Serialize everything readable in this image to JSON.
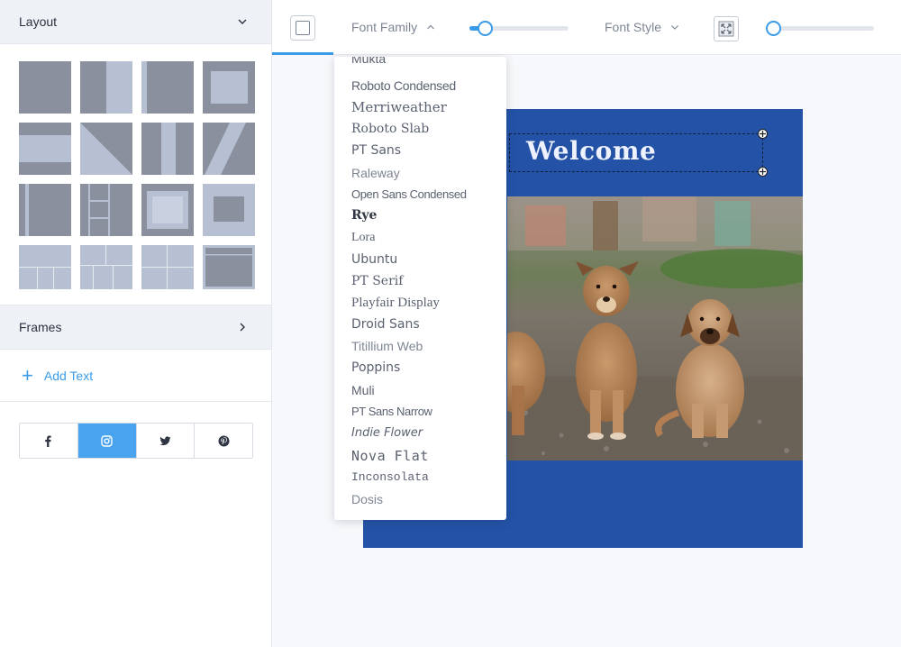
{
  "sidebar": {
    "layout_title": "Layout",
    "frames_title": "Frames",
    "add_text_label": "Add Text",
    "social": [
      {
        "name": "facebook",
        "icon": "facebook-icon",
        "active": false
      },
      {
        "name": "instagram",
        "icon": "instagram-icon",
        "active": true
      },
      {
        "name": "twitter",
        "icon": "twitter-icon",
        "active": false
      },
      {
        "name": "pinterest",
        "icon": "pinterest-icon",
        "active": false
      }
    ]
  },
  "toolbar": {
    "font_family_label": "Font Family",
    "font_style_label": "Font Style",
    "size_slider_value": 0.15,
    "second_slider_value": 0.0
  },
  "font_menu": {
    "items": [
      "Mukta",
      "Roboto Condensed",
      "Merriweather",
      "Roboto Slab",
      "PT Sans",
      "Raleway",
      "Open Sans Condensed",
      "Rye",
      "Lora",
      "Ubuntu",
      "PT Serif",
      "Playfair Display",
      "Droid Sans",
      "Titillium Web",
      "Poppins",
      "Muli",
      "PT Sans Narrow",
      "Indie Flower",
      "Nova Flat",
      "Inconsolata",
      "Dosis"
    ]
  },
  "canvas": {
    "headline": "Welcome",
    "card_color": "#2352a6"
  },
  "colors": {
    "accent": "#3b9be8",
    "tile_dark": "#8a909d",
    "tile_light": "#b7bfd3"
  }
}
